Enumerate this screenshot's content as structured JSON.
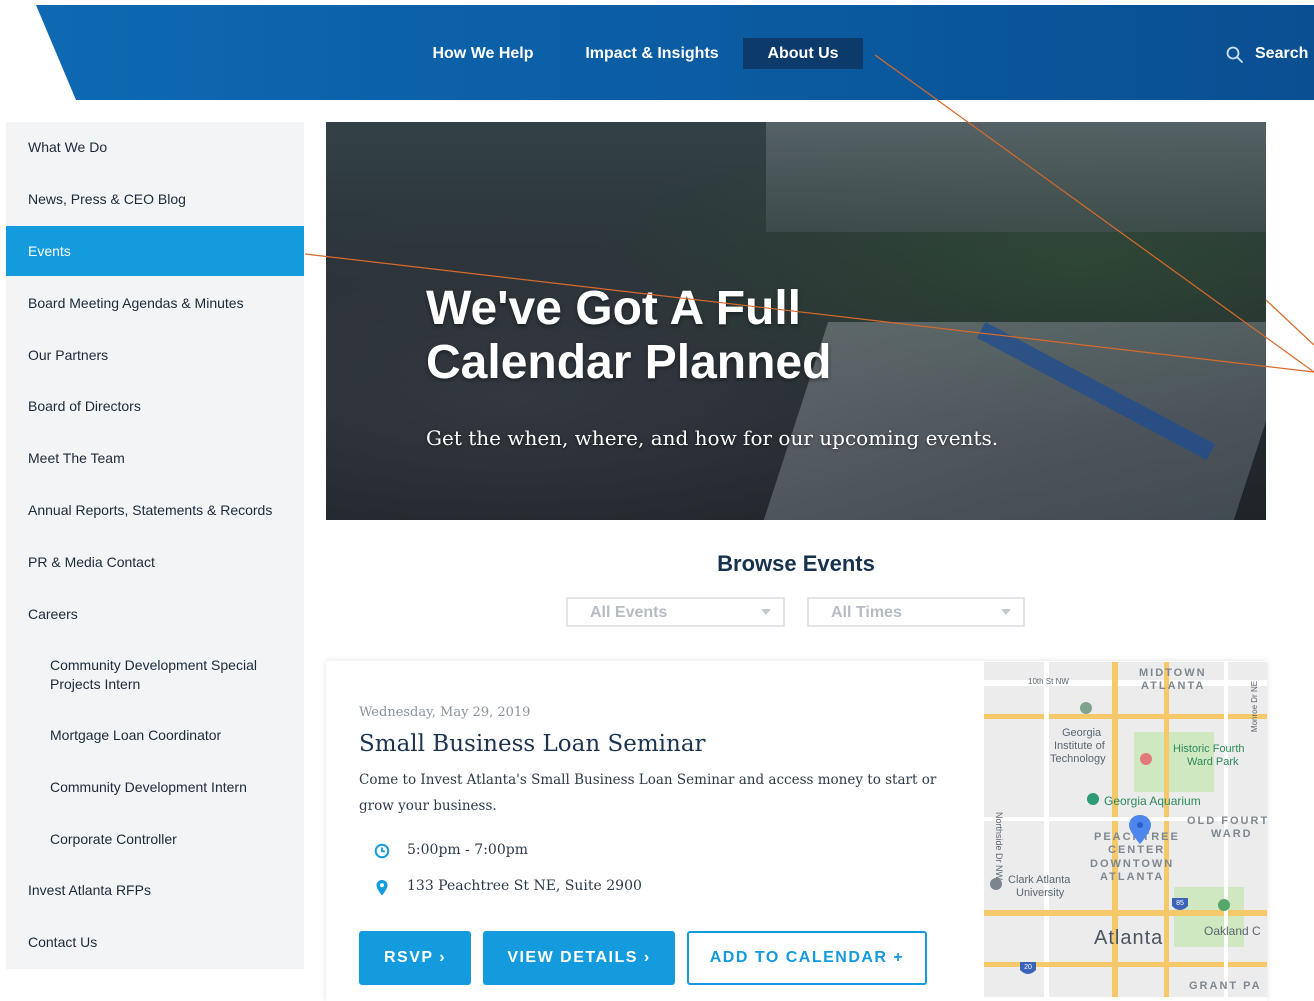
{
  "header": {
    "nav": [
      {
        "label": "How We Help",
        "active": false
      },
      {
        "label": "Impact & Insights",
        "active": false
      },
      {
        "label": "About Us",
        "active": true
      }
    ],
    "search_label": "Search"
  },
  "sidebar": {
    "items": [
      {
        "label": "What We Do"
      },
      {
        "label": "News, Press & CEO Blog"
      },
      {
        "label": "Events",
        "active": true
      },
      {
        "label": "Board Meeting Agendas & Minutes"
      },
      {
        "label": "Our Partners"
      },
      {
        "label": "Board of Directors"
      },
      {
        "label": "Meet The Team"
      },
      {
        "label": "Annual Reports, Statements & Records"
      },
      {
        "label": "PR & Media Contact"
      },
      {
        "label": "Careers"
      },
      {
        "label": "Community Development Special Projects Intern",
        "sub": true
      },
      {
        "label": "Mortgage Loan Coordinator",
        "sub": true
      },
      {
        "label": "Community Development Intern",
        "sub": true
      },
      {
        "label": "Corporate Controller",
        "sub": true
      },
      {
        "label": "Invest Atlanta RFPs"
      },
      {
        "label": "Contact Us"
      }
    ]
  },
  "hero": {
    "title_line1": "We've Got A Full",
    "title_line2": "Calendar Planned",
    "subtitle": "Get the when, where, and how for our upcoming events."
  },
  "browse": {
    "title": "Browse Events",
    "filter_events": "All Events",
    "filter_times": "All Times"
  },
  "event": {
    "date": "Wednesday, May 29, 2019",
    "title": "Small Business Loan Seminar",
    "description": "Come to Invest Atlanta's Small Business Loan Seminar and access money to start or grow your business.",
    "time": "5:00pm - 7:00pm",
    "address": "133 Peachtree St NE, Suite 2900",
    "buttons": {
      "rsvp": "RSVP ›",
      "details": "VIEW DETAILS ›",
      "calendar": "ADD TO CALENDAR +"
    }
  },
  "map": {
    "labels": {
      "midtown1": "MIDTOWN",
      "midtown2": "ATLANTA",
      "street10": "10th St NW",
      "monroe": "Monroe Dr NE",
      "gt1": "Georgia",
      "gt2": "Institute of",
      "gt3": "Technology",
      "hf1": "Historic Fourth",
      "hf2": "Ward Park",
      "aquarium": "Georgia Aquarium",
      "of1": "OLD FOURTH",
      "of2": "WARD",
      "northside": "Northside Dr NW",
      "pc1": "PEACHTREE",
      "pc2": "CENTER",
      "dt1": "DOWNTOWN",
      "dt2": "ATLANTA",
      "ca1": "Clark Atlanta",
      "ca2": "University",
      "atlanta": "Atlanta",
      "oakland": "Oakland C",
      "grant": "GRANT PA",
      "i85": "85",
      "i20": "20"
    }
  },
  "colors": {
    "brand_blue": "#139bde",
    "nav_active": "#0b3a6b",
    "annotation": "#d86a2a"
  }
}
